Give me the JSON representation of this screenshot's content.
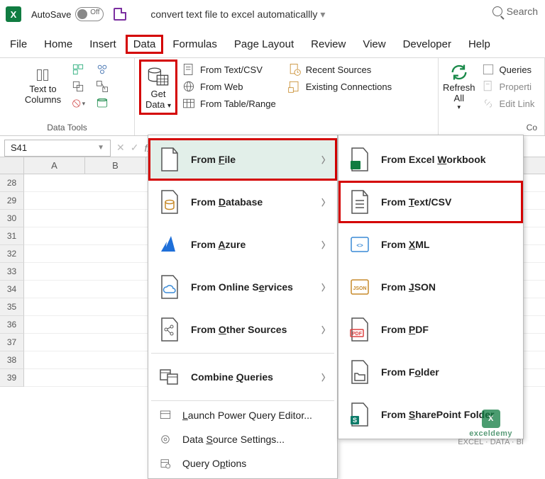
{
  "titlebar": {
    "autosave_label": "AutoSave",
    "autosave_state": "Off",
    "doc_title": "convert text file to excel automaticallly",
    "search_label": "Search"
  },
  "tabs": {
    "file": "File",
    "home": "Home",
    "insert": "Insert",
    "data": "Data",
    "formulas": "Formulas",
    "page_layout": "Page Layout",
    "review": "Review",
    "view": "View",
    "developer": "Developer",
    "help": "Help"
  },
  "ribbon": {
    "data_tools_label": "Data Tools",
    "text_to_columns": "Text to\nColumns",
    "get_data": "Get\nData",
    "from_text_csv": "From Text/CSV",
    "from_web": "From Web",
    "from_table_range": "From Table/Range",
    "recent_sources": "Recent Sources",
    "existing_connections": "Existing Connections",
    "refresh_all": "Refresh\nAll",
    "queries": "Queries",
    "properties": "Properti",
    "edit_links": "Edit Link",
    "queries_conn_label": "Co"
  },
  "namebox": {
    "value": "S41"
  },
  "sheet": {
    "columns": [
      "A",
      "B"
    ],
    "rows": [
      "28",
      "29",
      "30",
      "31",
      "32",
      "33",
      "34",
      "35",
      "36",
      "37",
      "38",
      "39"
    ]
  },
  "menu1": {
    "from_file": "From File",
    "from_database": "From Database",
    "from_azure": "From Azure",
    "from_online_services": "From Online Services",
    "from_other_sources": "From Other Sources",
    "combine_queries": "Combine Queries",
    "launch_pq": "Launch Power Query Editor...",
    "data_source_settings": "Data Source Settings...",
    "query_options": "Query Options"
  },
  "menu2": {
    "from_workbook": "From Excel Workbook",
    "from_text_csv": "From Text/CSV",
    "from_xml": "From XML",
    "from_json": "From JSON",
    "from_pdf": "From PDF",
    "from_folder": "From Folder",
    "from_sharepoint": "From SharePoint Folder"
  },
  "watermark": {
    "title": "exceldemy",
    "sub": "EXCEL · DATA · BI"
  }
}
